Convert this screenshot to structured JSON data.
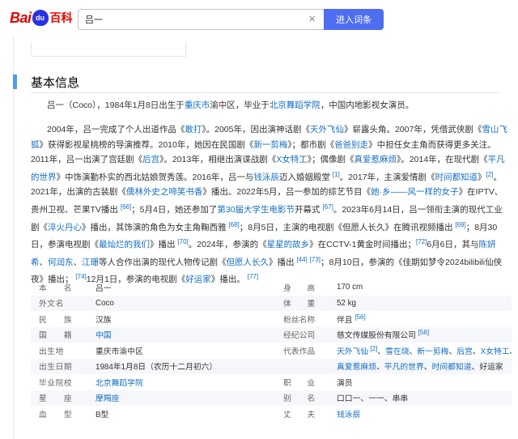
{
  "search": {
    "value": "吕一",
    "button": "进入词条"
  },
  "section_title": "基本信息",
  "para1": [
    {
      "t": "吕一（Coco），1984年1月8日出生于"
    },
    {
      "t": "重庆市",
      "l": 1
    },
    {
      "t": "渝中区，毕业于"
    },
    {
      "t": "北京舞蹈学院",
      "l": 1
    },
    {
      "t": "，中国内地影视女演员。"
    }
  ],
  "para2": [
    {
      "t": "2004年，吕一完成了个人出道作品《"
    },
    {
      "t": "敢打",
      "l": 1
    },
    {
      "t": "》。2005年，因出演神话剧《"
    },
    {
      "t": "天外飞仙",
      "l": 1
    },
    {
      "t": "》崭露头角。2007年，凭借武侠剧《"
    },
    {
      "t": "雪山飞狐",
      "l": 1
    },
    {
      "t": "》获得影视星桃榜的导演推荐。2010年，她因在民国剧《"
    },
    {
      "t": "新一剪梅",
      "l": 1
    },
    {
      "t": "》；都市剧《"
    },
    {
      "t": "爸爸别走",
      "l": 1
    },
    {
      "t": "》中担任女主角而获得更多关注。2011年，吕一出演了宫廷剧《"
    },
    {
      "t": "后宫",
      "l": 1
    },
    {
      "t": "》。2013年，相继出演谍战剧《"
    },
    {
      "t": "X女特工",
      "l": 1
    },
    {
      "t": "》；偶像剧《"
    },
    {
      "t": "真爱惹麻烦",
      "l": 1
    },
    {
      "t": "》。2014年，在现代剧《"
    },
    {
      "t": "平凡的世界",
      "l": 1
    },
    {
      "t": "》中饰演勤朴实的西北姑娘贺秀莲。2016年，吕一与"
    },
    {
      "t": "钱泳辰",
      "l": 1
    },
    {
      "t": "迈入婚姻殿堂 "
    },
    {
      "t": "[1]",
      "s": 1
    },
    {
      "t": "。2017年，主演爱情剧《"
    },
    {
      "t": "时间都知道",
      "l": 1
    },
    {
      "t": "》"
    },
    {
      "t": "[2]",
      "s": 1
    },
    {
      "t": "。2021年，出演的古装剧《"
    },
    {
      "t": "儒林外史之啼笑书香",
      "l": 1
    },
    {
      "t": "》播出。2022年5月，吕一参加的综艺节目《"
    },
    {
      "t": "她·乡——风一样的女子",
      "l": 1
    },
    {
      "t": "》在IPTV、贵州卫视、芒果TV播出 "
    },
    {
      "t": "[66]",
      "s": 1
    },
    {
      "t": "；5月4日，她还参加了"
    },
    {
      "t": "第30届大学生电影节",
      "l": 1
    },
    {
      "t": "开幕式 "
    },
    {
      "t": "[67]",
      "s": 1
    },
    {
      "t": "。2023年6月14日，吕一领衔主演的现代工业剧《"
    },
    {
      "t": "淬火丹心",
      "l": 1
    },
    {
      "t": "》播出，其饰演的角色为女主角鞠西雅 "
    },
    {
      "t": "[68]",
      "s": 1
    },
    {
      "t": "；8月5日，主演的电视剧《但愿人长久》在腾讯视频播出 "
    },
    {
      "t": "[69]",
      "s": 1
    },
    {
      "t": "；8月30日，参演电视剧《"
    },
    {
      "t": "最灿烂的我们",
      "l": 1
    },
    {
      "t": "》播出 "
    },
    {
      "t": "[70]",
      "s": 1
    },
    {
      "t": "。2024年，参演的《"
    },
    {
      "t": "星星的故乡",
      "l": 1
    },
    {
      "t": "》在CCTV-1黄金时间播出；"
    },
    {
      "t": "[72]",
      "s": 1
    },
    {
      "t": "6月6日，其与"
    },
    {
      "t": "陈妍希",
      "l": 1
    },
    {
      "t": "、"
    },
    {
      "t": "何润东",
      "l": 1
    },
    {
      "t": "、"
    },
    {
      "t": "江珊",
      "l": 1
    },
    {
      "t": "等人合作出演的现代人物传记剧《"
    },
    {
      "t": "但愿人长久",
      "l": 1
    },
    {
      "t": "》播出 "
    },
    {
      "t": "[44]",
      "s": 1
    },
    {
      "t": " "
    },
    {
      "t": "[73]",
      "s": 1
    },
    {
      "t": "；8月10日，参演的《佳期如梦令2024bilibili仙侠夜》播出； "
    },
    {
      "t": "[74]",
      "s": 1
    },
    {
      "t": "12月1日，参演的电视剧《"
    },
    {
      "t": "好运家",
      "l": 1
    },
    {
      "t": "》播出。 "
    },
    {
      "t": "[77]",
      "s": 1
    }
  ],
  "info_rows": [
    {
      "l1": "本　　名",
      "v1": [
        {
          "t": "吕一"
        }
      ],
      "l2": "身　　高",
      "v2": [
        {
          "t": "170 cm"
        }
      ]
    },
    {
      "l1": "外文名",
      "v1": [
        {
          "t": "Coco"
        }
      ],
      "l2": "体　　重",
      "v2": [
        {
          "t": "52 kg"
        }
      ]
    },
    {
      "l1": "民　　族",
      "v1": [
        {
          "t": "汉族"
        }
      ],
      "l2": "粉丝名称",
      "v2": [
        {
          "t": "伴且 "
        },
        {
          "t": "[56]",
          "s": 1
        }
      ]
    },
    {
      "l1": "国　　籍",
      "v1": [
        {
          "t": "中国",
          "l": 1
        }
      ],
      "l2": "经纪公司",
      "v2": [
        {
          "t": "慈文传媒股份有限公司 "
        },
        {
          "t": "[56]",
          "s": 1
        }
      ]
    },
    {
      "l1": "出生地",
      "v1": [
        {
          "t": "重庆市渝中区"
        }
      ],
      "l2": "代表作品",
      "v2": [
        {
          "t": "天外飞仙",
          "l": 1
        },
        {
          "t": " [2]",
          "s": 1
        },
        {
          "t": "、"
        },
        {
          "t": "雪在烧",
          "l": 1
        },
        {
          "t": "、"
        },
        {
          "t": "新一剪梅",
          "l": 1
        },
        {
          "t": "、"
        },
        {
          "t": "后宫",
          "l": 1
        },
        {
          "t": "、"
        },
        {
          "t": "X女特工",
          "l": 1
        },
        {
          "t": "、"
        }
      ]
    },
    {
      "l1": "出生日期",
      "v1": [
        {
          "t": "1984年1月8日（农历十二月初六）"
        }
      ],
      "l2": "",
      "v2": [
        {
          "t": "真爱惹麻烦",
          "l": 1
        },
        {
          "t": "、"
        },
        {
          "t": "平凡的世界",
          "l": 1
        },
        {
          "t": "、"
        },
        {
          "t": "时间都知道",
          "l": 1
        },
        {
          "t": "、好运家"
        }
      ]
    },
    {
      "l1": "毕业院校",
      "v1": [
        {
          "t": "北京舞蹈学院",
          "l": 1
        }
      ],
      "l2": "职　　业",
      "v2": [
        {
          "t": "演员"
        }
      ]
    },
    {
      "l1": "星　　座",
      "v1": [
        {
          "t": "摩羯座",
          "l": 1
        }
      ],
      "l2": "别　　名",
      "v2": [
        {
          "t": "口口一、一一、串串"
        }
      ]
    },
    {
      "l1": "血　　型",
      "v1": [
        {
          "t": "B型"
        }
      ],
      "l2": "丈　　夫",
      "v2": [
        {
          "t": "钱泳辰",
          "l": 1
        }
      ]
    }
  ]
}
